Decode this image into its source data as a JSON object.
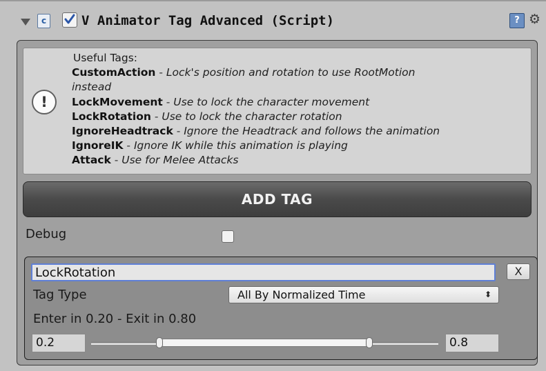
{
  "component": {
    "title": "V Animator Tag Advanced (Script)",
    "enabled": true,
    "icons": {
      "foldout": "foldout-arrow-icon",
      "script": "script-icon",
      "help": "help-book-icon",
      "settings": "gear-icon"
    }
  },
  "help": {
    "heading": "Useful Tags:",
    "entries": [
      {
        "tag": "CustomAction",
        "sep": " - ",
        "desc": "Lock's position and rotation to use RootMotion",
        "wrap": "instead"
      },
      {
        "tag": "LockMovement",
        "sep": " - ",
        "desc": "Use to lock the character movement"
      },
      {
        "tag": "LockRotation",
        "sep": " - ",
        "desc": "Use to lock the character rotation"
      },
      {
        "tag": "IgnoreHeadtrack",
        "sep": " - ",
        "desc": "Ignore the Headtrack and follows the animation"
      },
      {
        "tag": "IgnoreIK",
        "sep": " - ",
        "desc": "Ignore IK while this animation is playing"
      },
      {
        "tag": "Attack",
        "sep": " - ",
        "desc": "Use for Melee Attacks"
      }
    ],
    "icon": "info-exclamation-icon"
  },
  "add_tag_label": "ADD TAG",
  "debug": {
    "label": "Debug",
    "checked": false
  },
  "tag": {
    "name": "LockRotation",
    "remove_label": "X",
    "type_label": "Tag Type",
    "type_value": "All By Normalized Time",
    "range_text": "Enter in 0.20 - Exit in 0.80",
    "min_value": "0.2",
    "max_value": "0.8"
  },
  "colors": {
    "background": "#c2c2c2",
    "panel": "#a0a0a0",
    "focus_outline": "#5e7fd6"
  }
}
